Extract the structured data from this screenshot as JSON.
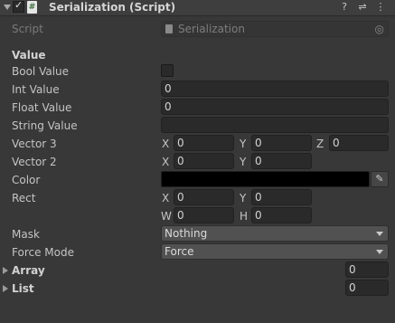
{
  "header": {
    "title": "Serialization (Script)",
    "script_glyph": "#",
    "help_glyph": "?",
    "settings_glyph": "⇌",
    "menu_glyph": "⋮"
  },
  "script_row": {
    "label": "Script",
    "value": "Serialization",
    "object_glyph": "◎"
  },
  "section_title": "Value",
  "fields": {
    "bool_label": "Bool Value",
    "bool_value": false,
    "int_label": "Int Value",
    "int_value": "0",
    "float_label": "Float Value",
    "float_value": "0",
    "string_label": "String Value",
    "string_value": "",
    "vector3_label": "Vector 3",
    "vector3": {
      "x_label": "X",
      "x": "0",
      "y_label": "Y",
      "y": "0",
      "z_label": "Z",
      "z": "0"
    },
    "vector2_label": "Vector 2",
    "vector2": {
      "x_label": "X",
      "x": "0",
      "y_label": "Y",
      "y": "0"
    },
    "color_label": "Color",
    "color_value": "#000000",
    "rect_label": "Rect",
    "rect": {
      "x_label": "X",
      "x": "0",
      "y_label": "Y",
      "y": "0",
      "w_label": "W",
      "w": "0",
      "h_label": "H",
      "h": "0"
    },
    "mask_label": "Mask",
    "mask_value": "Nothing",
    "force_mode_label": "Force Mode",
    "force_mode_value": "Force",
    "array_label": "Array",
    "array_size": "0",
    "list_label": "List",
    "list_size": "0"
  },
  "icons": {
    "picker_glyph": "✎"
  }
}
